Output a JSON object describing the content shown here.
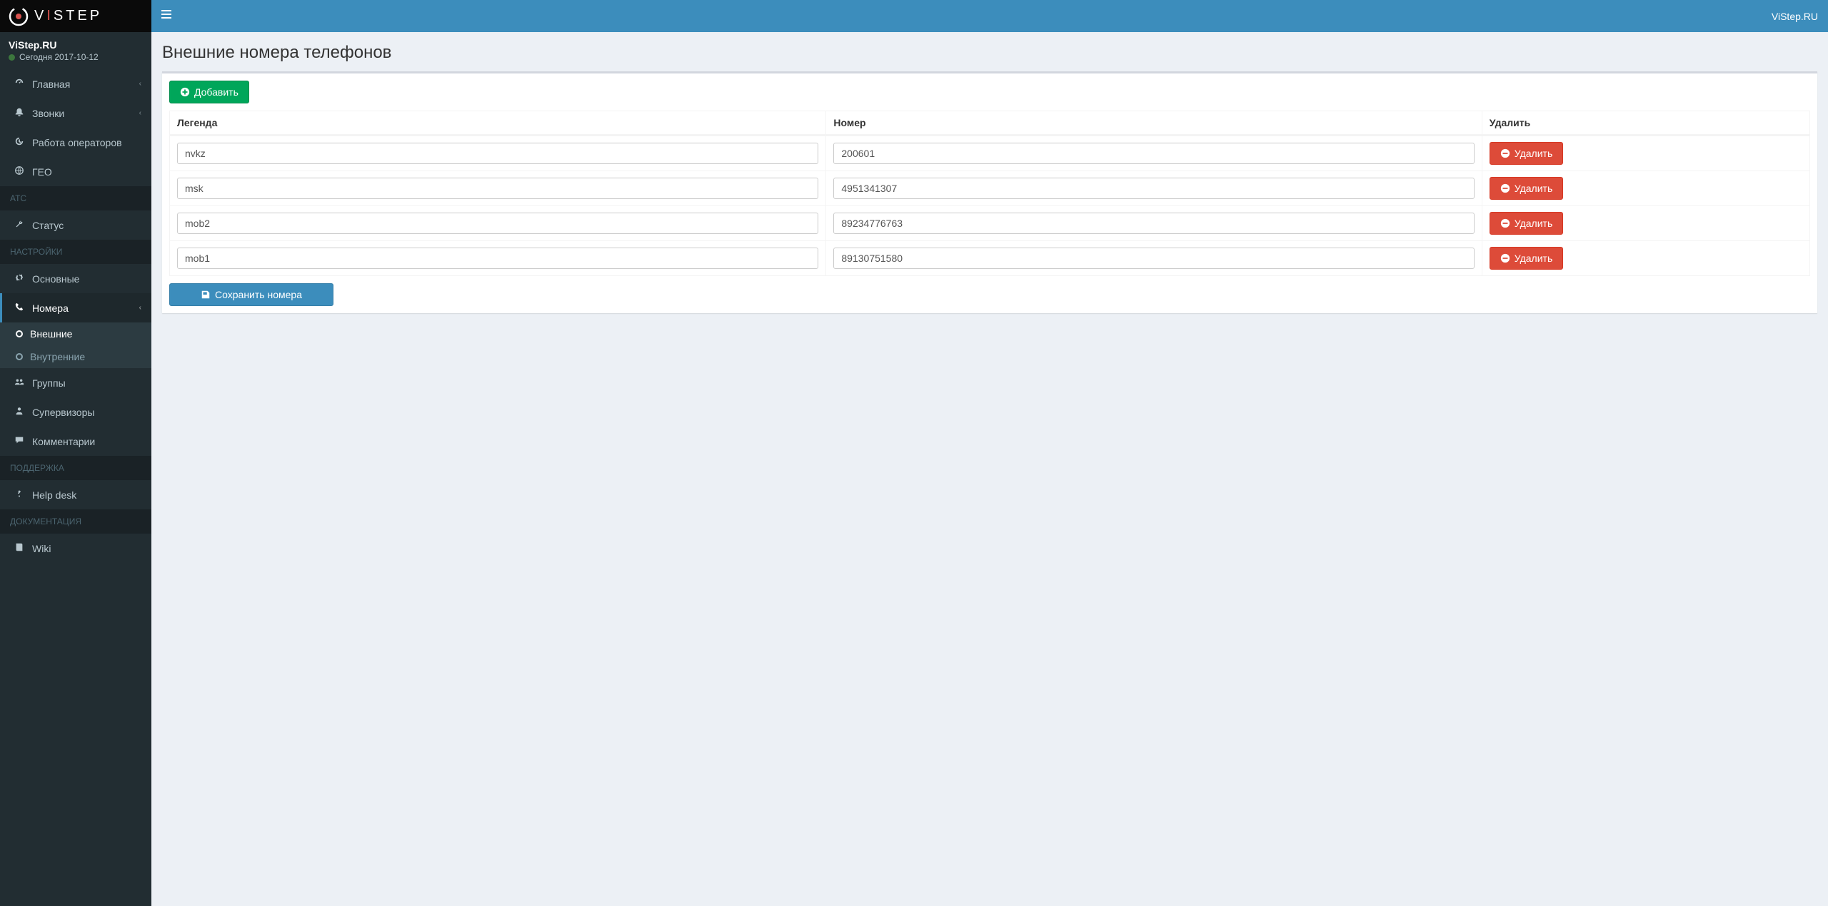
{
  "brand": {
    "text": "VISTEP"
  },
  "user_panel": {
    "name": "ViStep.RU",
    "date_prefix": "Сегодня",
    "date": "2017-10-12"
  },
  "topbar": {
    "right_label": "ViStep.RU"
  },
  "sidebar": {
    "items_top": [
      {
        "label": "Главная",
        "has_chevron": true
      },
      {
        "label": "Звонки",
        "has_chevron": true
      },
      {
        "label": "Работа операторов",
        "has_chevron": false
      },
      {
        "label": "ГЕО",
        "has_chevron": false
      }
    ],
    "section_atc": "АТС",
    "atc_items": [
      {
        "label": "Статус"
      }
    ],
    "section_settings": "НАСТРОЙКИ",
    "settings_items": [
      {
        "label": "Основные"
      },
      {
        "label": "Номера",
        "active": true,
        "children": [
          {
            "label": "Внешние",
            "active": true
          },
          {
            "label": "Внутренние",
            "active": false
          }
        ]
      },
      {
        "label": "Группы"
      },
      {
        "label": "Супервизоры"
      },
      {
        "label": "Комментарии"
      }
    ],
    "section_support": "ПОДДЕРЖКА",
    "support_items": [
      {
        "label": "Help desk"
      }
    ],
    "section_docs": "ДОКУМЕНТАЦИЯ",
    "docs_items": [
      {
        "label": "Wiki"
      }
    ]
  },
  "page": {
    "title": "Внешние номера телефонов",
    "add_label": "Добавить",
    "save_label": "Сохранить номера",
    "columns": {
      "legend": "Легенда",
      "number": "Номер",
      "delete": "Удалить"
    },
    "delete_btn_label": "Удалить",
    "rows": [
      {
        "legend": "nvkz",
        "number": "200601"
      },
      {
        "legend": "msk",
        "number": "4951341307"
      },
      {
        "legend": "mob2",
        "number": "89234776763"
      },
      {
        "legend": "mob1",
        "number": "89130751580"
      }
    ]
  }
}
